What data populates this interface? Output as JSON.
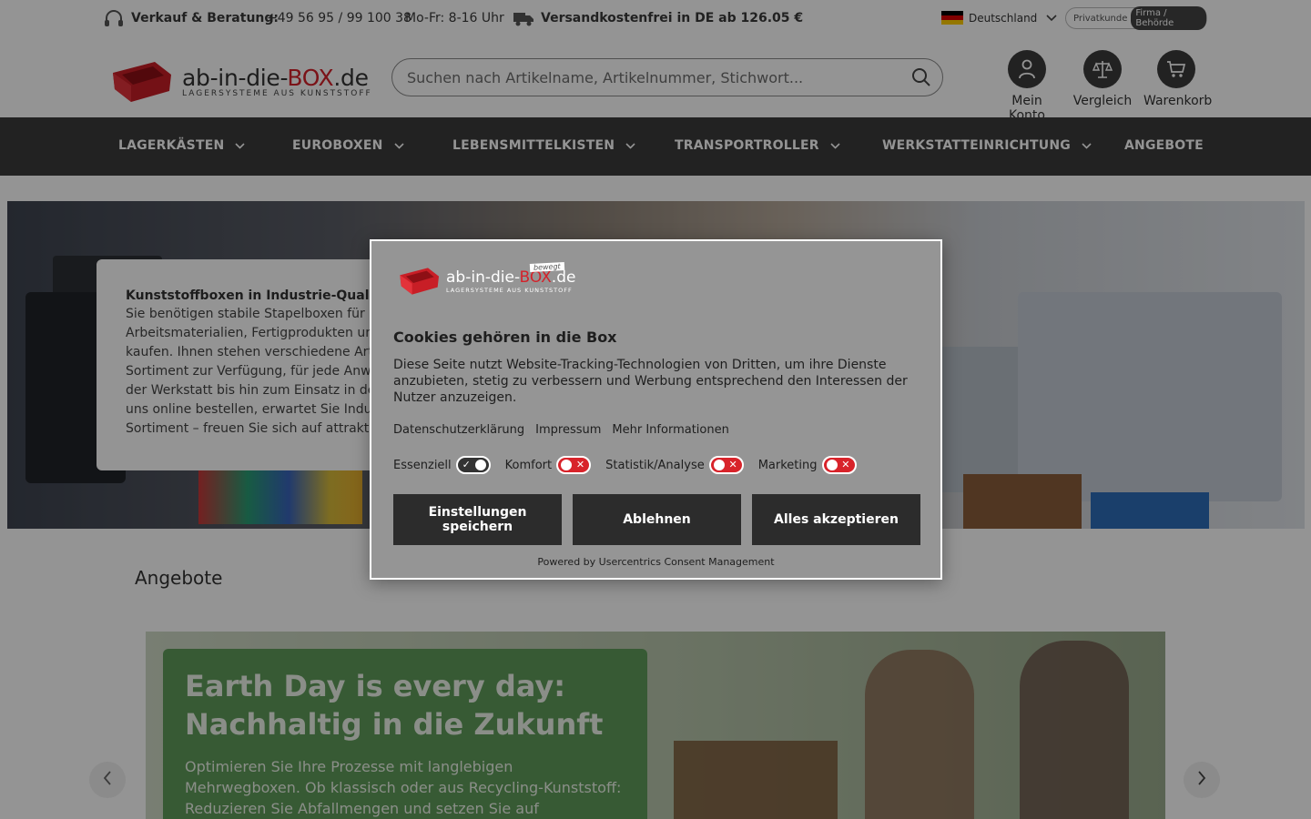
{
  "topbar": {
    "contact_label": "Verkauf & Beratung:",
    "phone": "+49 56 95 / 99 100 38",
    "hours": "Mo-Fr: 8-16 Uhr",
    "shipping": "Versandkostenfrei in DE ab 126.05 €",
    "country": "Deutschland",
    "customer_private": "Privatkunde",
    "customer_business": "Firma / Behörde"
  },
  "header": {
    "logo_main_1": "ab-in-die-",
    "logo_main_red": "BOX",
    "logo_main_2": ".de",
    "logo_sub": "LAGERSYSTEME AUS KUNSTSTOFF",
    "search_placeholder": "Suchen nach Artikelname, Artikelnummer, Stichwort...",
    "account_label": "Mein Konto",
    "compare_label": "Vergleich",
    "cart_label": "Warenkorb"
  },
  "nav": {
    "items": [
      {
        "label": "LAGERKÄSTEN"
      },
      {
        "label": "EUROBOXEN"
      },
      {
        "label": "LEBENSMITTELKISTEN"
      },
      {
        "label": "TRANSPORTROLLER"
      },
      {
        "label": "WERKSTATTEINRICHTUNG"
      },
      {
        "label": "ANGEBOTE"
      }
    ]
  },
  "hero": {
    "title": "Kunststoffboxen in Industrie-Qualität",
    "text": "Sie benötigen stabile Stapelboxen für die\nArbeitsmaterialien, Fertigprodukten und G\nkaufen. Ihnen stehen verschiedene Arten\nSortiment zur Verfügung, für jede Anwend\nder Werkstatt bis hin zum Einsatz in der A\nuns online bestellen, erwartet Sie Industr\nSortiment – freuen Sie sich auf attraktive"
  },
  "offers": {
    "title": "Angebote",
    "promo_title": "Earth Day is every day: Nachhaltig in die Zukunft",
    "promo_text": "Optimieren Sie Ihre Prozesse mit langlebigen Mehrwegboxen. Ob klassisch oder aus Recycling-Kunststoff: Reduzieren Sie Abfallmengen und setzen Sie auf Verantwortung in Profi-Qualität."
  },
  "cookie": {
    "logo_main_1": "ab-in-die-",
    "logo_main_red": "BOX",
    "logo_main_2": ".de",
    "logo_sub": "LAGERSYSTEME AUS KUNSTSTOFF",
    "logo_tag": "bewegt",
    "title": "Cookies gehören in die Box",
    "description": "Diese Seite nutzt Website-Tracking-Technologien von Dritten, um ihre Dienste anzubieten, stetig zu verbessern und Werbung entsprechend den Interessen der Nutzer anzuzeigen.",
    "link_privacy": "Datenschutzerklärung",
    "link_imprint": "Impressum",
    "link_more": "Mehr Informationen",
    "toggles": [
      {
        "label": "Essenziell",
        "state": "on"
      },
      {
        "label": "Komfort",
        "state": "off"
      },
      {
        "label": "Statistik/Analyse",
        "state": "off"
      },
      {
        "label": "Marketing",
        "state": "off"
      }
    ],
    "btn_save": "Einstellungen speichern",
    "btn_deny": "Ablehnen",
    "btn_accept": "Alles akzeptieren",
    "powered": "Powered by Usercentrics Consent Management"
  },
  "colors": {
    "brand_red": "#d4222a",
    "nav_bg": "#3b3b3b",
    "promo_green": "#5f9c5a"
  }
}
